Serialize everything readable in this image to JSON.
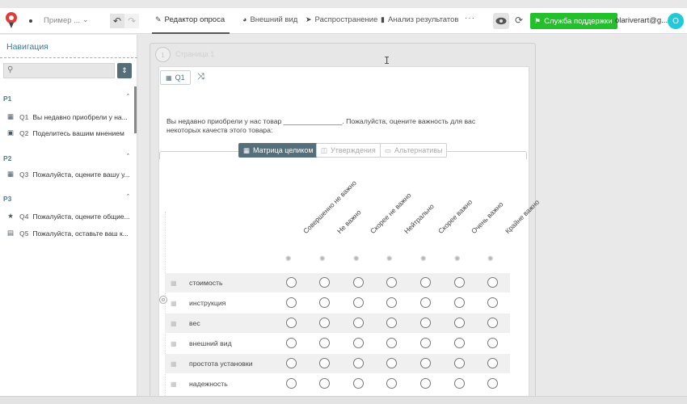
{
  "topbar": {
    "project_name": "Пример ...",
    "tabs": [
      {
        "label": "Редактор опроса",
        "icon": "ruler-pen-icon"
      },
      {
        "label": "Внешний вид",
        "icon": "palette-icon"
      },
      {
        "label": "Распространение",
        "icon": "send-icon"
      },
      {
        "label": "Анализ результатов",
        "icon": "bar-chart-icon"
      }
    ],
    "more_label": "···",
    "support_label": "Служба поддержки",
    "user_label": "olariverart@g...",
    "avatar_letter": "O",
    "accent_green": "#22c02a",
    "avatar_color": "#21c9d9"
  },
  "sidebar": {
    "title": "Навигация",
    "search_placeholder": "",
    "sections": [
      {
        "label": "P1",
        "items": [
          {
            "num": "Q1",
            "text": "Вы недавно приобрели у на...",
            "icon": "grid-icon"
          },
          {
            "num": "Q2",
            "text": "Поделитесь вашим мнением",
            "icon": "comment-icon"
          }
        ]
      },
      {
        "label": "P2",
        "items": [
          {
            "num": "Q3",
            "text": "Пожалуйста, оцените вашу у...",
            "icon": "grid-icon"
          }
        ]
      },
      {
        "label": "P3",
        "items": [
          {
            "num": "Q4",
            "text": "Пожалуйста, оцените общие...",
            "icon": "star-icon"
          },
          {
            "num": "Q5",
            "text": "Пожалуйста, оставьте ваш к...",
            "icon": "form-icon"
          }
        ]
      }
    ]
  },
  "editor": {
    "page_number": "1",
    "page_label": "Страница 1",
    "question_id": "Q1",
    "question_text": "Вы недавно приобрели у нас товар _______________. Пожалуйста, оцените важность для вас некоторых качеств этого товара:",
    "modes": [
      {
        "label": "Матрица целиком",
        "active": true
      },
      {
        "label": "Утверждения",
        "active": false
      },
      {
        "label": "Альтернативы",
        "active": false
      }
    ],
    "columns": [
      "Совершенно не важно",
      "Не важно",
      "Скорее не важно",
      "Нейтрально",
      "Скорее важно",
      "Очень важно",
      "Крайне важно"
    ],
    "rows": [
      "стоимость",
      "инструкция",
      "вес",
      "внешний вид",
      "простота установки",
      "надежность"
    ]
  }
}
